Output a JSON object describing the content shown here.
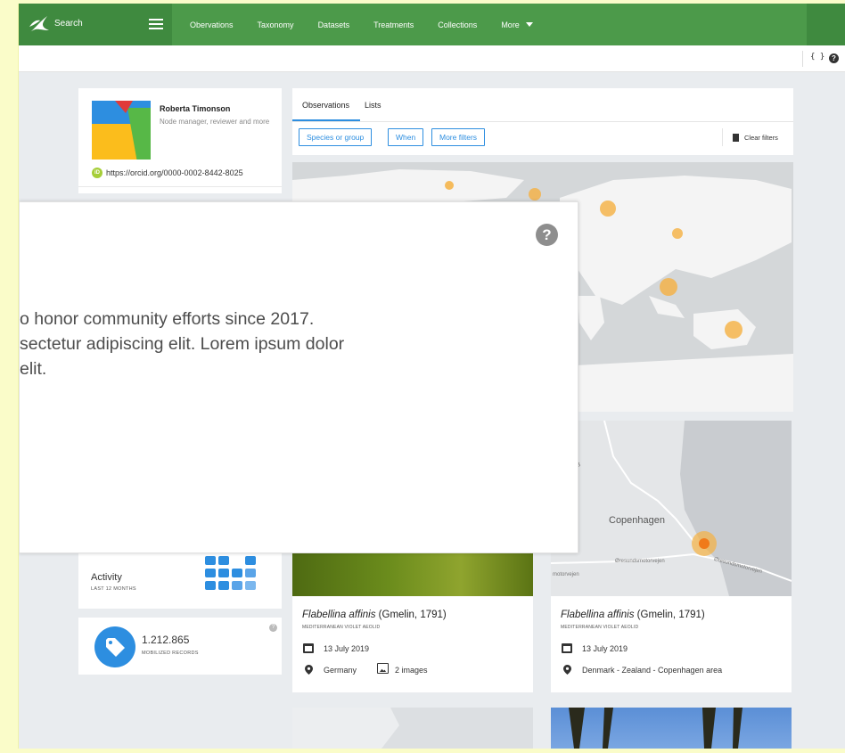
{
  "header": {
    "search_label": "Search",
    "nav": [
      "Obervations",
      "Taxonomy",
      "Datasets",
      "Treatments",
      "Collections"
    ],
    "more_label": "More"
  },
  "toolbar": {
    "code_icon": "code-braces-icon",
    "help_icon": "help-icon"
  },
  "profile": {
    "name": "Roberta Timonson",
    "role": "Node manager, reviewer and more",
    "orcid_badge": "iD",
    "orcid_url": "https://orcid.org/0000-0002-8442-8025"
  },
  "tabs": {
    "observations": "Observations",
    "lists": "Lists"
  },
  "filters": {
    "species": "Species or group",
    "when": "When",
    "more": "More filters",
    "clear": "Clear filters"
  },
  "maps": {
    "city_label": "Copenhagen",
    "street_1": "Øresundsmotorvejen",
    "street_2": "Øresundsmotorvejen",
    "street_3": "motorvejen",
    "road_num": "ing 3"
  },
  "activity": {
    "title": "Activity",
    "subtitle": "LAST 12 MONTHS"
  },
  "records": {
    "value": "1.212.865",
    "label": "MOBILIZED RECORDS",
    "help": "?"
  },
  "occurrences": [
    {
      "species": "Flabellina affinis",
      "author": "(Gmelin, 1791)",
      "common": "MEDITERRANEAN VIOLET AEOLID",
      "date": "13 July 2019",
      "place": "Germany",
      "images": "2 images"
    },
    {
      "species": "Flabellina affinis",
      "author": "(Gmelin, 1791)",
      "common": "MEDITERRANEAN VIOLET AEOLID",
      "date": "13 July 2019",
      "place": "Denmark - Zealand - Copenhagen area"
    }
  ],
  "modal": {
    "help": "?",
    "line1": "o honor community efforts since 2017.",
    "line2": "sectetur adipiscing elit. Lorem ipsum dolor",
    "line3": "elit."
  },
  "colors": {
    "header_green": "#4c9a4a",
    "accent_blue": "#2d8ee0",
    "map_dot": "#f5b041",
    "map_dot_highlight": "#f07a1a",
    "frame_yellow": "#fafcc9"
  }
}
